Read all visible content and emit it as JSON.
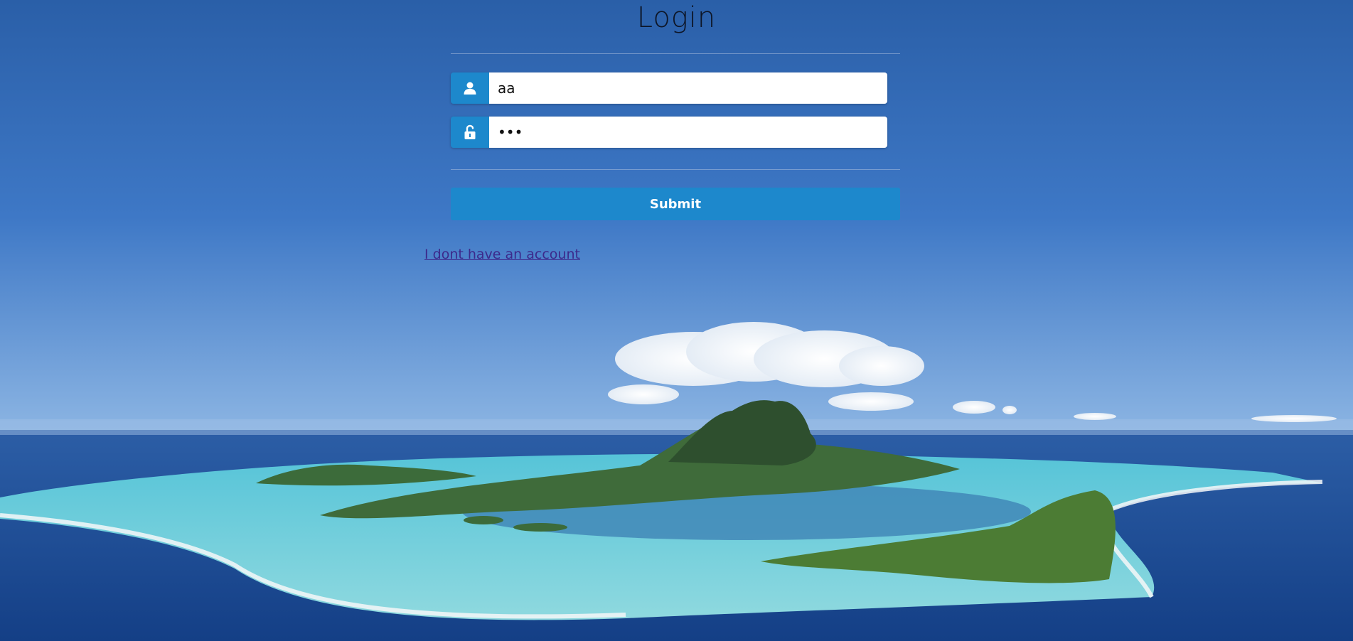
{
  "page": {
    "title": "Login"
  },
  "form": {
    "username_value": "aa",
    "password_value": "abc",
    "submit_label": "Submit",
    "account_link_label": "I dont have an account"
  },
  "icons": {
    "username": "user-icon",
    "password": "unlock-icon"
  },
  "colors": {
    "accent": "#1d88cc",
    "link": "#3c2a8c",
    "title": "#0d1526"
  },
  "background": {
    "description_icon": "island-landscape-image"
  }
}
